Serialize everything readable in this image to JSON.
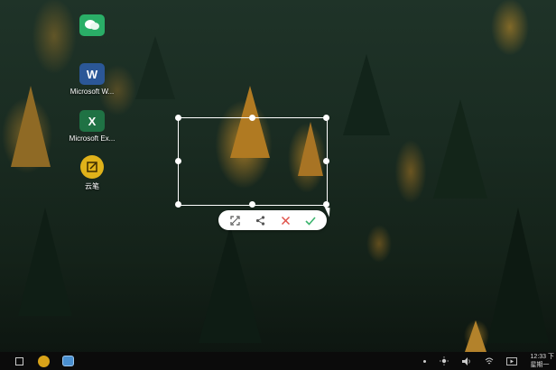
{
  "desktop": {
    "icons": [
      {
        "name": "wechat",
        "label": "",
        "color": "#2aae67"
      },
      {
        "name": "microsoft-word",
        "label": "Microsoft W...",
        "color": "#2b5797"
      },
      {
        "name": "microsoft-excel",
        "label": "Microsoft Ex...",
        "color": "#1f7244"
      },
      {
        "name": "yunbi",
        "label": "云笔",
        "color": "#e0b21a"
      }
    ]
  },
  "capture_toolbar": {
    "buttons": [
      "expand-icon",
      "share-icon",
      "close-icon",
      "check-icon"
    ],
    "accent_cancel": "#e0524a",
    "accent_confirm": "#3cb46e"
  },
  "taskbar": {
    "clock_time": "12:33 下",
    "clock_date": "星期一"
  }
}
